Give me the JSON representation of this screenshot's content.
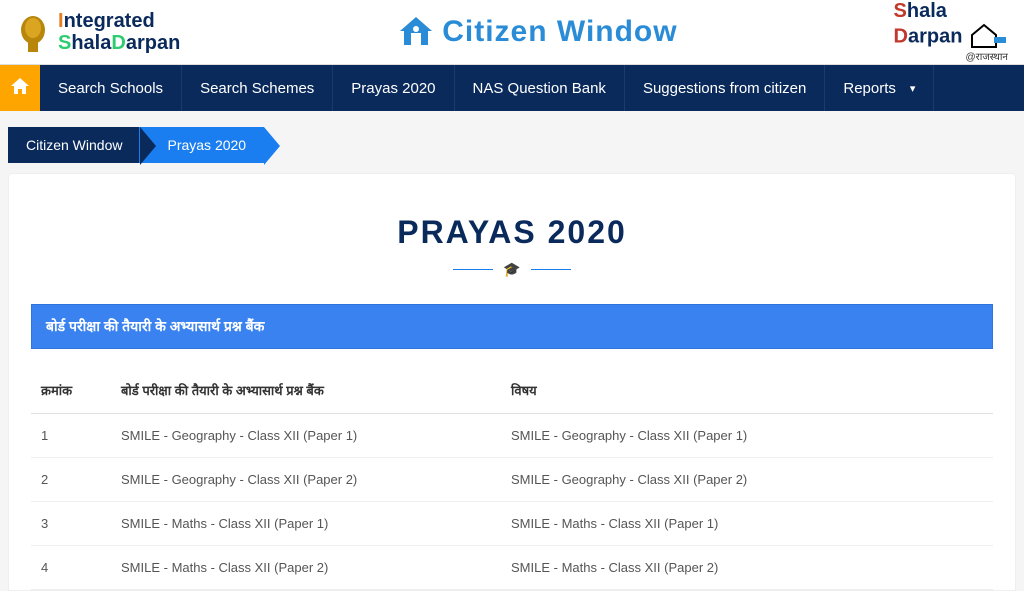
{
  "header": {
    "left_logo_line1_i": "I",
    "left_logo_line1_rest": "ntegrated",
    "left_logo_line2_s": "S",
    "left_logo_line2_mid": "hala",
    "left_logo_line2_d": "D",
    "left_logo_line2_end": "arpan",
    "center_title": "Citizen Window",
    "right_s": "S",
    "right_hala": "hala",
    "right_d": "D",
    "right_arpan": "arpan",
    "right_sub": "@राजस्थान"
  },
  "nav": {
    "items": [
      "Search Schools",
      "Search Schemes",
      "Prayas 2020",
      "NAS Question Bank",
      "Suggestions from citizen",
      "Reports"
    ]
  },
  "breadcrumb": {
    "a": "Citizen Window",
    "b": "Prayas 2020"
  },
  "page": {
    "title": "PRAYAS 2020",
    "section_heading": "बोर्ड परीक्षा की तैयारी के अभ्यासार्थ प्रश्न बैंक"
  },
  "table": {
    "headers": {
      "sn": "क्रमांक",
      "desc": "बोर्ड परीक्षा की तैयारी के अभ्यासार्थ प्रश्न बैंक",
      "subject": "विषय"
    },
    "rows": [
      {
        "sn": "1",
        "desc": "SMILE - Geography - Class XII (Paper 1)",
        "subject": "SMILE - Geography - Class XII (Paper 1)"
      },
      {
        "sn": "2",
        "desc": "SMILE - Geography - Class XII (Paper 2)",
        "subject": "SMILE - Geography - Class XII (Paper 2)"
      },
      {
        "sn": "3",
        "desc": "SMILE - Maths - Class XII (Paper 1)",
        "subject": "SMILE - Maths - Class XII (Paper 1)"
      },
      {
        "sn": "4",
        "desc": "SMILE - Maths - Class XII (Paper 2)",
        "subject": "SMILE - Maths - Class XII (Paper 2)"
      }
    ]
  }
}
